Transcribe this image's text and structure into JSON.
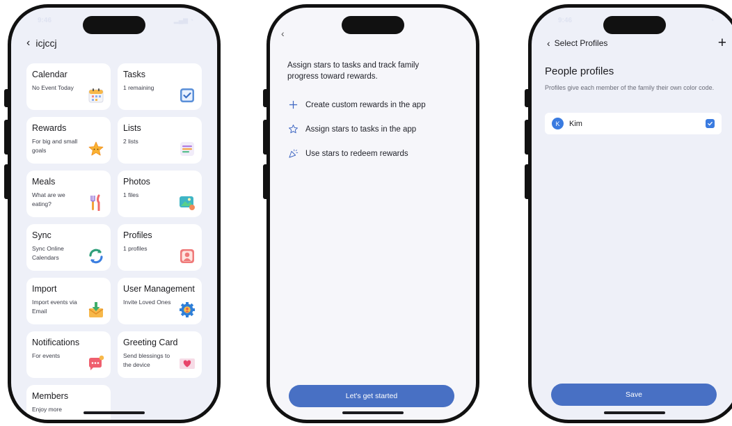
{
  "phone1": {
    "status_time": "9:46",
    "header_title": "icjccj",
    "cards": [
      {
        "title": "Calendar",
        "subtitle": "No Event Today",
        "icon": "calendar-icon"
      },
      {
        "title": "Tasks",
        "subtitle": "1 remaining",
        "icon": "checkbox-icon"
      },
      {
        "title": "Rewards",
        "subtitle": "For big and small goals",
        "icon": "star-icon"
      },
      {
        "title": "Lists",
        "subtitle": "2 lists",
        "icon": "list-icon"
      },
      {
        "title": "Meals",
        "subtitle": "What are we eating?",
        "icon": "cutlery-icon"
      },
      {
        "title": "Photos",
        "subtitle": "1 files",
        "icon": "photo-icon"
      },
      {
        "title": "Sync",
        "subtitle": "Sync Online Calendars",
        "icon": "sync-icon"
      },
      {
        "title": "Profiles",
        "subtitle": "1 profiles",
        "icon": "profile-icon"
      },
      {
        "title": "Import",
        "subtitle": "Import events via Email",
        "icon": "email-import-icon"
      },
      {
        "title": "User Management",
        "subtitle": "Invite Loved Ones",
        "icon": "gear-user-icon"
      },
      {
        "title": "Notifications",
        "subtitle": "For events",
        "icon": "chat-bubble-icon"
      },
      {
        "title": "Greeting Card",
        "subtitle": "Send blessings to the device",
        "icon": "heart-card-icon"
      },
      {
        "title": "Members",
        "subtitle": "Enjoy more",
        "icon": "crown-icon"
      }
    ]
  },
  "phone2": {
    "intro": "Assign stars to tasks and track family progress toward rewards.",
    "features": [
      {
        "icon": "plus-icon",
        "label": "Create custom rewards in the app"
      },
      {
        "icon": "star-outline-icon",
        "label": "Assign stars to tasks in the app"
      },
      {
        "icon": "party-popper-icon",
        "label": "Use stars to redeem rewards"
      }
    ],
    "cta": "Let's get started"
  },
  "phone3": {
    "status_time": "9:46",
    "header_title": "Select Profiles",
    "section_title": "People profiles",
    "description": "Profiles give each member of the family their own color code.",
    "profile": {
      "initial": "K",
      "name": "Kim",
      "checked": true
    },
    "save": "Save"
  },
  "colors": {
    "accent": "#4870c4",
    "checkbox": "#3a7be0",
    "background": "#eef0f8"
  }
}
